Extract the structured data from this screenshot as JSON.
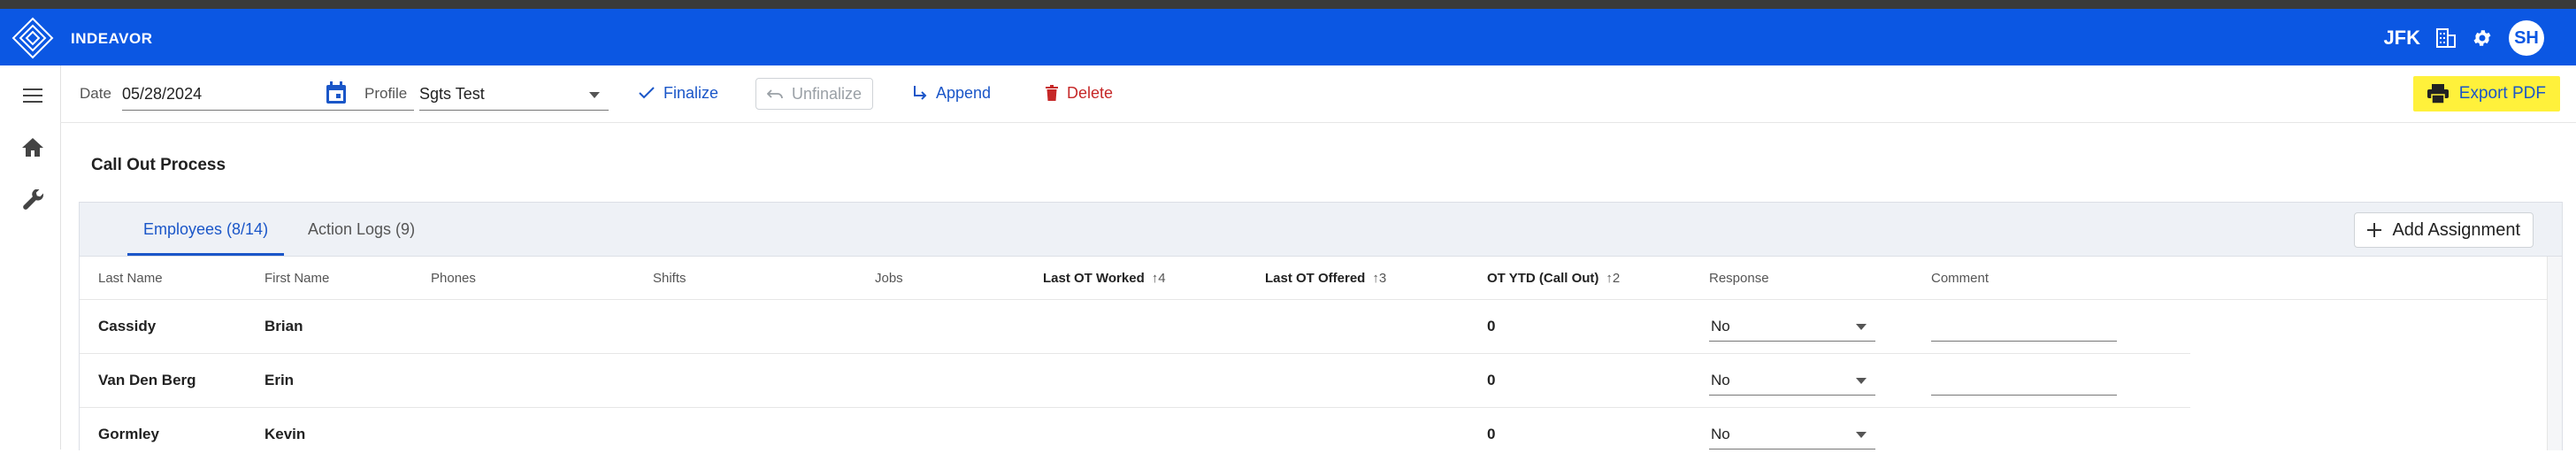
{
  "app": {
    "brand": "INDEAVOR",
    "airport": "JFK",
    "user_initials": "SH",
    "accent": "#0b57e3"
  },
  "toolbar": {
    "date_label": "Date",
    "date_value": "05/28/2024",
    "profile_label": "Profile",
    "profile_value": "Sgts Test",
    "finalize": "Finalize",
    "unfinalize": "Unfinalize",
    "append": "Append",
    "delete": "Delete",
    "export_pdf": "Export PDF"
  },
  "page": {
    "title": "Call Out Process"
  },
  "tabs": [
    {
      "label": "Employees (8/14)",
      "active": true
    },
    {
      "label": "Action Logs (9)",
      "active": false
    }
  ],
  "add_assignment": "Add Assignment",
  "columns": {
    "last_name": "Last Name",
    "first_name": "First Name",
    "phones": "Phones",
    "shifts": "Shifts",
    "jobs": "Jobs",
    "last_ot_worked": "Last OT Worked",
    "last_ot_worked_sort": "↑4",
    "last_ot_offered": "Last OT Offered",
    "last_ot_offered_sort": "↑3",
    "ot_ytd": "OT YTD (Call Out)",
    "ot_ytd_sort": "↑2",
    "response": "Response",
    "comment": "Comment"
  },
  "rows": [
    {
      "last_name": "Cassidy",
      "first_name": "Brian",
      "ot_ytd": "0",
      "response": "No"
    },
    {
      "last_name": "Van Den Berg",
      "first_name": "Erin",
      "ot_ytd": "0",
      "response": "No"
    },
    {
      "last_name": "Gormley",
      "first_name": "Kevin",
      "ot_ytd": "0",
      "response": "No"
    }
  ]
}
